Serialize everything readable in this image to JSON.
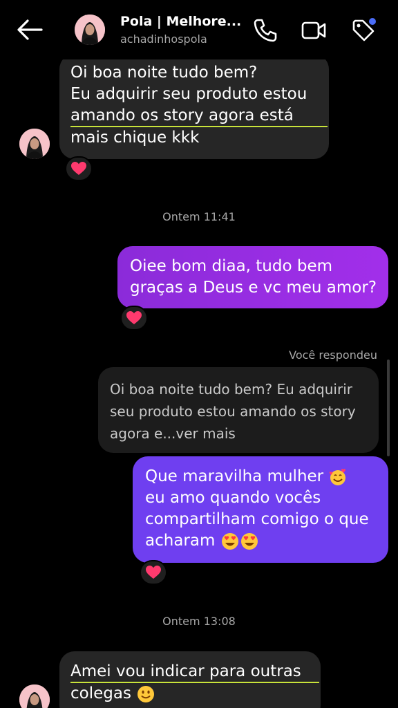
{
  "header": {
    "title": "Pola | Melhore...",
    "username": "achadinhospola",
    "back_icon": "arrow-left-icon",
    "call_icon": "phone-icon",
    "video_icon": "video-camera-icon",
    "tag_icon": "tag-icon",
    "dot_color": "#4a6cf7"
  },
  "messages": {
    "m1": {
      "line1": "Oi boa noite tudo bem?",
      "line2": "Eu adquirir seu produto estou",
      "line3": "amando os story agora está",
      "line4": "mais chique kkk",
      "reaction": "heart"
    },
    "stamp1": "Ontem 11:41",
    "m2": {
      "line1": "Oiee bom diaa, tudo bem",
      "line2": "graças a Deus e vc meu amor?",
      "reaction": "heart"
    },
    "replied_label": "Você respondeu",
    "quote": {
      "line1": "Oi boa noite tudo bem?",
      "line2": "Eu adquirir seu produto estou",
      "line3": "amando os story agora e...ver mais"
    },
    "m3": {
      "line1": "Que maravilha mulher",
      "line2": "eu amo quando vocês",
      "line3": "compartilham comigo o que",
      "line4": "acharam",
      "reaction": "heart"
    },
    "stamp2": "Ontem 13:08",
    "m4": {
      "line1": "Amei vou indicar para outras",
      "line2": "colegas"
    }
  },
  "colors": {
    "incoming_bubble": "#262626",
    "outgoing_purple": "#a22fea",
    "outgoing_violet": "#6f3ff0",
    "underline": "#c8e33a"
  }
}
